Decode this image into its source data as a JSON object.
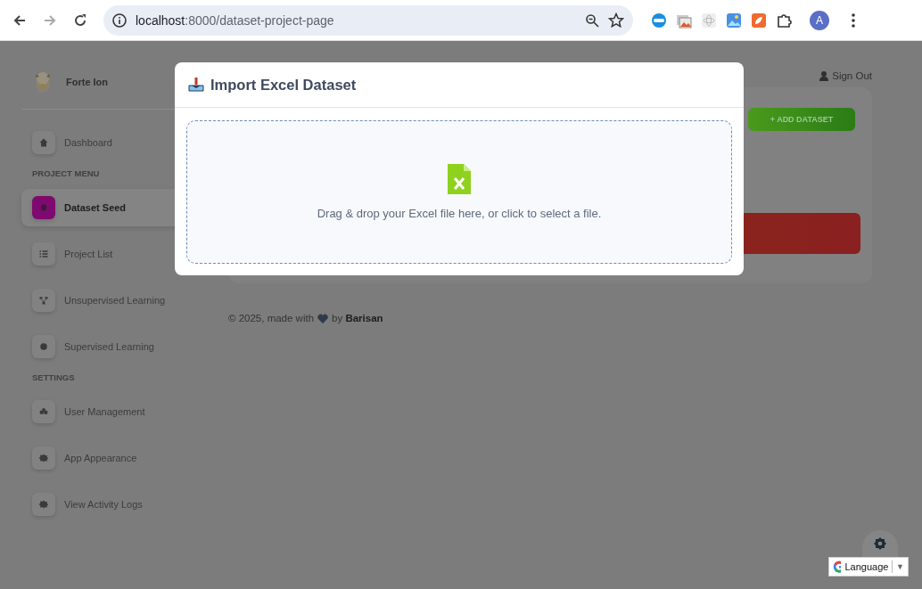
{
  "browser": {
    "url_host": "localhost",
    "url_rest": ":8000/dataset-project-page",
    "profile": "A"
  },
  "sidebar": {
    "brand": "Forte Ion",
    "items": [
      {
        "kind": "link",
        "label": "Dashboard",
        "selected": false
      },
      {
        "kind": "heading",
        "label": "PROJECT MENU"
      },
      {
        "kind": "link",
        "label": "Dataset Seed",
        "selected": true
      },
      {
        "kind": "link",
        "label": "Project List",
        "selected": false
      },
      {
        "kind": "link",
        "label": "Unsupervised Learning",
        "selected": false
      },
      {
        "kind": "link",
        "label": "Supervised Learning",
        "selected": false
      },
      {
        "kind": "heading",
        "label": "SETTINGS"
      },
      {
        "kind": "link",
        "label": "User Management",
        "selected": false
      },
      {
        "kind": "link",
        "label": "App Appearance",
        "selected": false
      },
      {
        "kind": "link",
        "label": "View Activity Logs",
        "selected": false
      }
    ]
  },
  "header": {
    "sign_out": "Sign Out"
  },
  "card": {
    "add_button": "+ ADD DATASET"
  },
  "footer": {
    "start": "© 2025, made with",
    "end": "by **Barisan**"
  },
  "modal": {
    "title": "Import Excel Dataset",
    "dropzone_text": "Drag & drop your Excel file here, or click to select a file."
  },
  "language": {
    "label": "Language",
    "arrow": "▼"
  }
}
